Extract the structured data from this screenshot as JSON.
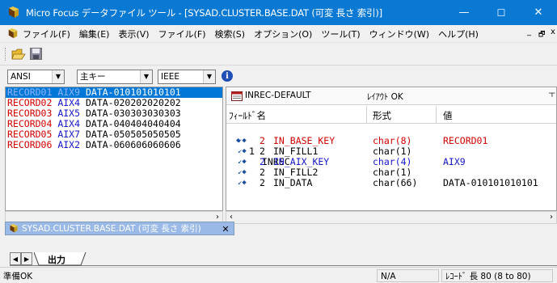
{
  "window": {
    "title": "Micro Focus データファイル ツール - [SYSAD.CLUSTER.BASE.DAT (可変 長さ 索引)]",
    "min_glyph": "—",
    "max_glyph": "☐",
    "close_glyph": "✕"
  },
  "menu": {
    "items": [
      "ファイル(F)",
      "編集(E)",
      "表示(V)",
      "ファイル(F)",
      "検索(S)",
      "オプション(O)",
      "ツール(T)",
      "ウィンドウ(W)",
      "ヘルプ(H)"
    ],
    "mdi_min": "_",
    "mdi_restore": "🗗",
    "mdi_close": "x"
  },
  "toolbar2": {
    "charset": "ANSI",
    "key": "主キー",
    "float_format": "IEEE",
    "info_glyph": "i"
  },
  "records": [
    {
      "name": "RECORD01",
      "aix": "AIX9",
      "data": "DATA-010101010101",
      "selected": true
    },
    {
      "name": "RECORD02",
      "aix": "AIX4",
      "data": "DATA-020202020202",
      "selected": false
    },
    {
      "name": "RECORD03",
      "aix": "AIX5",
      "data": "DATA-030303030303",
      "selected": false
    },
    {
      "name": "RECORD04",
      "aix": "AIX4",
      "data": "DATA-040404040404",
      "selected": false
    },
    {
      "name": "RECORD05",
      "aix": "AIX7",
      "data": "DATA-050505050505",
      "selected": false
    },
    {
      "name": "RECORD06",
      "aix": "AIX2",
      "data": "DATA-060606060606",
      "selected": false
    }
  ],
  "layout_panel": {
    "layout_name": "INREC-DEFAULT",
    "layout_status": "ﾚｲｱｳﾄ OK",
    "col_field": "ﾌｨｰﾙﾄﾞ名",
    "col_format": "形式",
    "col_value": "値",
    "root": {
      "level": "1",
      "name": "INREC"
    },
    "fields": [
      {
        "level": "2",
        "name": "IN_BASE_KEY",
        "format": "char(8)",
        "value": "RECORD01",
        "color": "red"
      },
      {
        "level": "2",
        "name": "IN_FILL1",
        "format": "char(1)",
        "value": "",
        "color": "black"
      },
      {
        "level": "2",
        "name": "IN_AIX_KEY",
        "format": "char(4)",
        "value": "AIX9",
        "color": "blue"
      },
      {
        "level": "2",
        "name": "IN_FILL2",
        "format": "char(1)",
        "value": "",
        "color": "black"
      },
      {
        "level": "2",
        "name": "IN_DATA",
        "format": "char(66)",
        "value": "DATA-010101010101",
        "color": "black"
      }
    ]
  },
  "doc_tab": {
    "label": "SYSAD.CLUSTER.BASE.DAT (可変 長さ 索引)",
    "close_glyph": "✕"
  },
  "output_tab": {
    "label": "出力"
  },
  "status": {
    "ready": "準備OK",
    "na": "N/A",
    "record_len": "ﾚｺｰﾄﾞ 長 80 (8 to 80)"
  },
  "colors": {
    "titlebar": "#0a79d3",
    "selection": "#0078d7",
    "key_red": "#d00000",
    "aix_blue": "#1515c8"
  }
}
